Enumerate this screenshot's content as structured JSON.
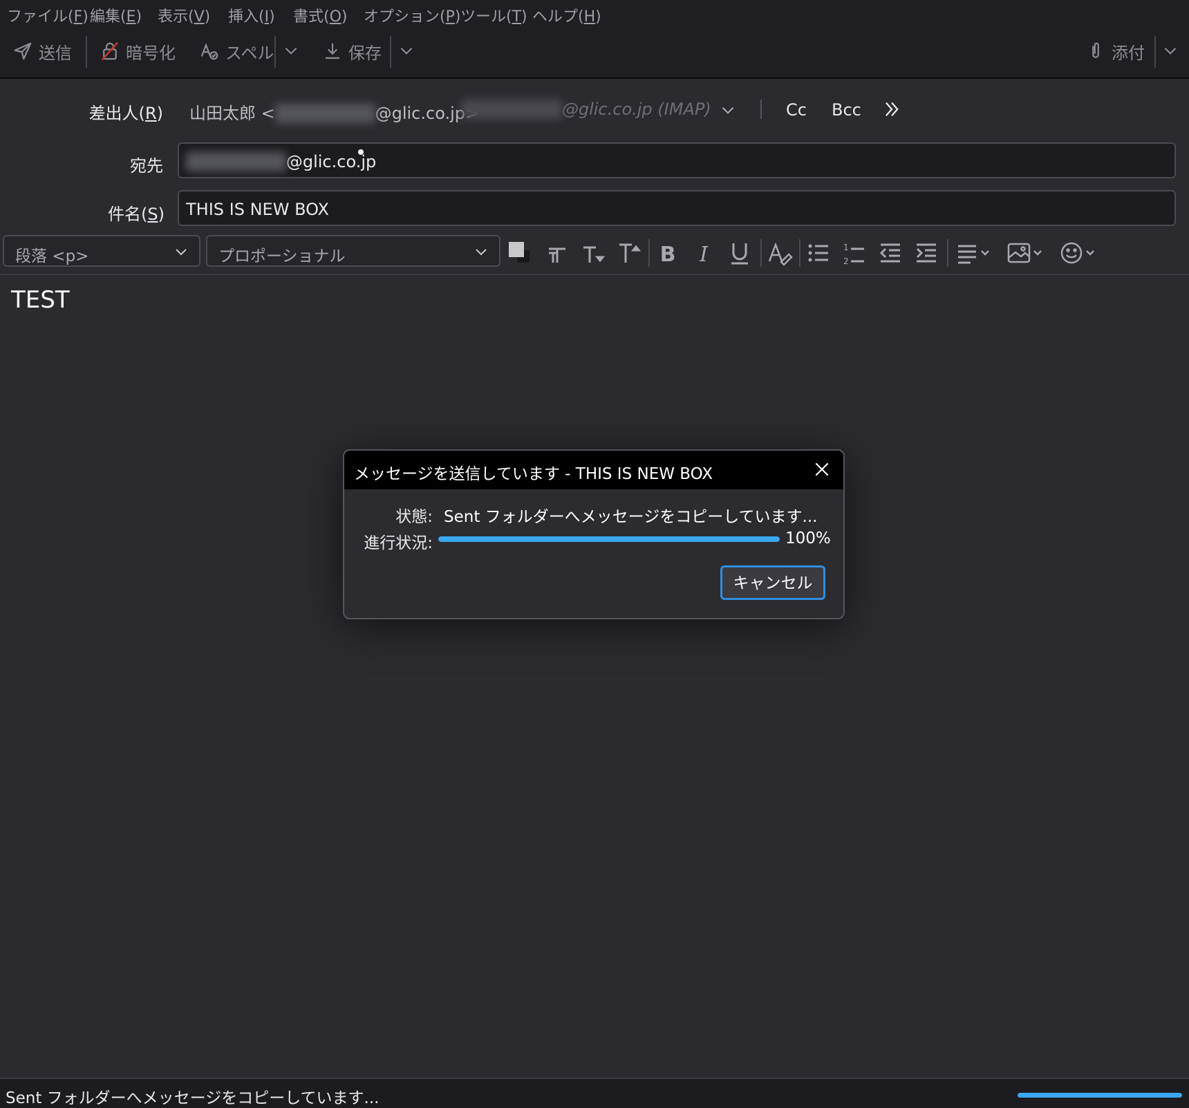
{
  "menu": [
    {
      "label": "ファイル(",
      "key": "F",
      "tail": ")"
    },
    {
      "label": "編集(",
      "key": "E",
      "tail": ")"
    },
    {
      "label": "表示(",
      "key": "V",
      "tail": ")"
    },
    {
      "label": "挿入(",
      "key": "I",
      "tail": ")"
    },
    {
      "label": "書式(",
      "key": "O",
      "tail": ")"
    },
    {
      "label": "オプション(",
      "key": "P",
      "tail": ")"
    },
    {
      "label": "ツール(",
      "key": "T",
      "tail": ")"
    },
    {
      "label": "ヘルプ(",
      "key": "H",
      "tail": ")"
    }
  ],
  "toolbar": {
    "send": "送信",
    "encrypt": "暗号化",
    "spell": "スペル",
    "save": "保存",
    "attach": "添付"
  },
  "header": {
    "from_label": "差出人(",
    "from_key": "R",
    "from_tail": ")",
    "from_name": "山田太郎 <",
    "from_blur": "system_test",
    "from_domain": "@glic.co.jp>",
    "from_identity_blur": "system_test",
    "from_identity": "@glic.co.jp (IMAP)",
    "cc": "Cc",
    "bcc": "Bcc",
    "to_label": "宛先",
    "to_blur": "system_test",
    "to_domain": "@glic.co.jp",
    "subject_label": "件名(",
    "subject_key": "S",
    "subject_tail": ")",
    "subject": "THIS IS NEW BOX"
  },
  "format": {
    "paragraph": "段落 <p>",
    "font": "プロポーショナル"
  },
  "body": {
    "text": "TEST"
  },
  "dialog": {
    "title": "メッセージを送信しています - THIS IS NEW BOX",
    "status_label": "状態:",
    "status_text": "Sent フォルダーへメッセージをコピーしています...",
    "progress_label": "進行状況:",
    "progress_value": 100,
    "progress_text": "100%",
    "cancel": "キャンセル"
  },
  "statusbar": {
    "text": "Sent フォルダーへメッセージをコピーしています...",
    "progress_value": 100
  },
  "colors": {
    "accent": "#3aa8f0",
    "background": "#2a2a2f"
  }
}
